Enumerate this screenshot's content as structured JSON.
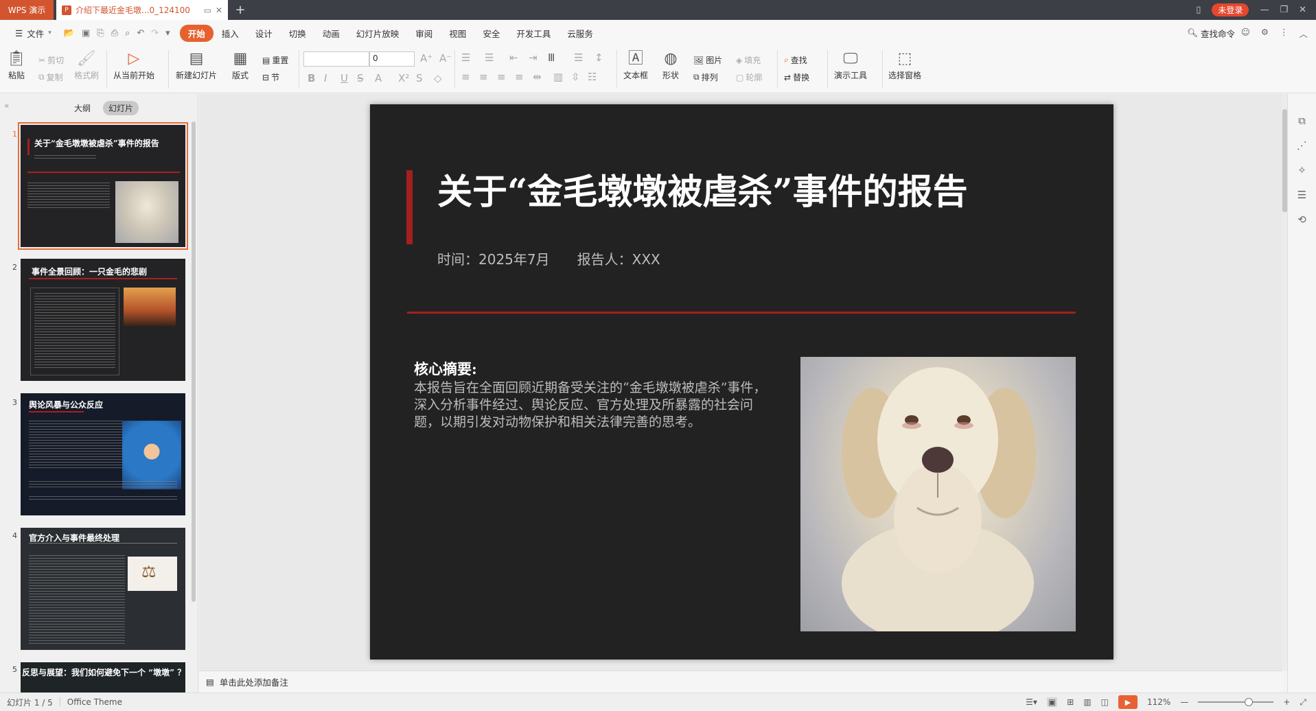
{
  "titlebar": {
    "app_tab": "WPS 演示",
    "doc_tab": "介绍下最近金毛墩...0_124100",
    "new_tab": "+",
    "login": "未登录"
  },
  "menubar": {
    "file": "文件",
    "tabs": [
      "开始",
      "插入",
      "设计",
      "切换",
      "动画",
      "幻灯片放映",
      "审阅",
      "视图",
      "安全",
      "开发工具",
      "云服务"
    ],
    "active_tab": "开始",
    "search": "查找命令"
  },
  "ribbon": {
    "paste": "粘贴",
    "cut": "剪切",
    "copy": "复制",
    "format_painter": "格式刷",
    "play_from_current": "从当前开始",
    "new_slide": "新建幻灯片",
    "layout": "版式",
    "reset": "重置",
    "section": "节",
    "font_name": "",
    "font_size": "0",
    "textbox": "文本框",
    "shape": "形状",
    "picture": "图片",
    "fill": "填充",
    "arrange": "排列",
    "outline": "轮廓",
    "find": "查找",
    "replace": "替换",
    "presentation_tools": "演示工具",
    "selection_pane": "选择窗格"
  },
  "panel": {
    "tabs": [
      "大纲",
      "幻灯片"
    ],
    "selected_tab": "幻灯片",
    "thumbnails": [
      {
        "num": "1",
        "title": "关于“金毛墩墩被虐杀”事件的报告"
      },
      {
        "num": "2",
        "title": "事件全景回顾：一只金毛的悲剧"
      },
      {
        "num": "3",
        "title": "舆论风暴与公众反应"
      },
      {
        "num": "4",
        "title": "官方介入与事件最终处理"
      },
      {
        "num": "5",
        "title": "反思与展望：我们如何避免下一个 “墩墩” ？"
      }
    ]
  },
  "slide": {
    "title": "关于“金毛墩墩被虐杀”事件的报告",
    "time": "时间：2025年7月",
    "reporter": "报告人：XXX",
    "summary_title": "核心摘要:",
    "summary_body": "本报告旨在全面回顾近期备受关注的“金毛墩墩被虐杀”事件，深入分析事件经过、舆论反应、官方处理及所暴露的社会问题，以期引发对动物保护和相关法律完善的思考。"
  },
  "notes": {
    "placeholder": "单击此处添加备注"
  },
  "status": {
    "slide_info": "幻灯片 1 / 5",
    "theme": "Office Theme",
    "zoom": "112%"
  },
  "colors": {
    "accent": "#e6612e",
    "slide_bg": "#222223",
    "slide_red": "#a3201d"
  }
}
